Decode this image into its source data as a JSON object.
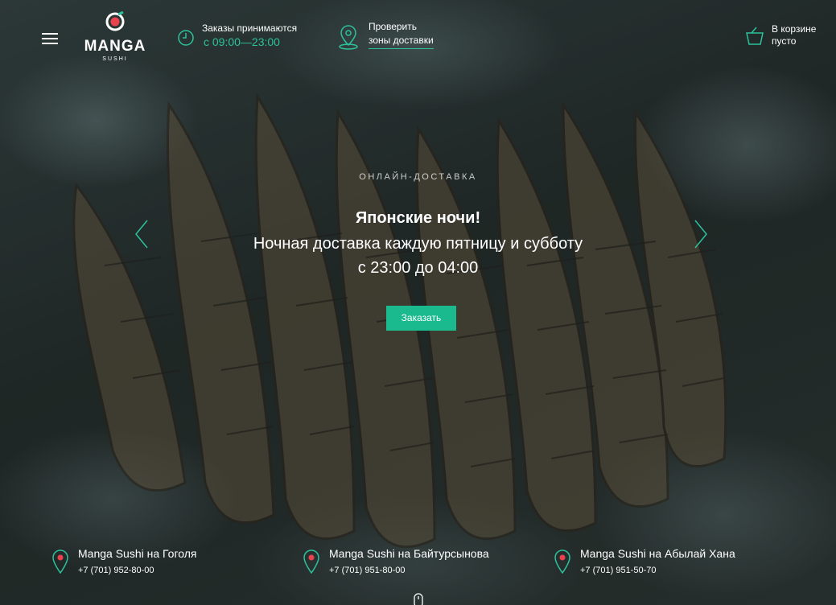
{
  "brand": {
    "name": "MANGA",
    "sub": "SUSHI"
  },
  "header": {
    "hours_label": "Заказы принимаются",
    "hours_value": "с 09:00—23:00",
    "zones_line1": "Проверить",
    "zones_line2": "зоны доставки",
    "cart_line1": "В корзине",
    "cart_line2": "пусто"
  },
  "hero": {
    "eyebrow": "ОНЛАЙН-ДОСТАВКА",
    "title": "Японские ночи!",
    "line1": "Ночная доставка каждую пятницу и субботу",
    "line2": "с 23:00 до 04:00",
    "button": "Заказать"
  },
  "locations": [
    {
      "name": "Manga Sushi на Гоголя",
      "phone": "+7 (701) 952-80-00"
    },
    {
      "name": "Manga Sushi на Байтурсынова",
      "phone": "+7 (701) 951-80-00"
    },
    {
      "name": "Manga Sushi на Абылай Хана",
      "phone": "+7 (701) 951-50-70"
    }
  ],
  "colors": {
    "accent": "#1ab98e",
    "accent_text": "#2cc29d",
    "logo_red": "#e8424e"
  },
  "icons": [
    "menu-icon",
    "clock-icon",
    "map-pin-icon",
    "basket-icon",
    "chevron-left-icon",
    "chevron-right-icon",
    "location-pin-icon",
    "scroll-mouse-icon"
  ]
}
